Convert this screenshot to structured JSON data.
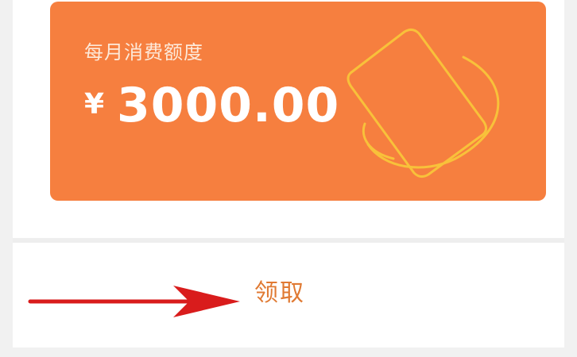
{
  "card": {
    "label": "每月消费额度",
    "currency": "¥",
    "amount": "3000.00",
    "background_color": "#f67f3f",
    "decoration_icon": "card-orbit-icon"
  },
  "action": {
    "claim_label": "领取",
    "color": "#e07a33"
  },
  "annotation": {
    "icon": "arrow-right-icon",
    "color": "#d91c1c"
  }
}
